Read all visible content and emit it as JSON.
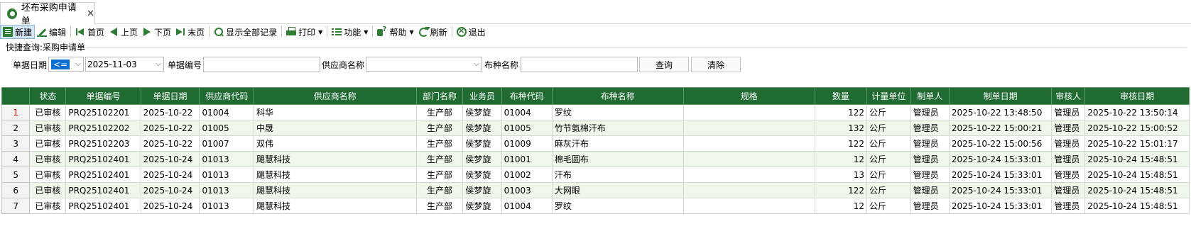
{
  "tab": {
    "title": "坯布采购申请单",
    "close": "✕"
  },
  "toolbar": {
    "new": "新建",
    "edit": "编辑",
    "first": "首页",
    "prev": "上页",
    "next": "下页",
    "last": "末页",
    "show_all": "显示全部记录",
    "print": "打印",
    "functions": "功能",
    "help": "帮助",
    "refresh": "刷新",
    "exit": "退出"
  },
  "quick_search": {
    "legend": "快捷查询:采购申请单",
    "date_label": "单据日期",
    "operator": "<=",
    "date_value": "2025-11-03",
    "doc_no_label": "单据编号",
    "doc_no_value": "",
    "supplier_label": "供应商名称",
    "supplier_value": "",
    "fabric_label": "布种名称",
    "fabric_value": "",
    "query_button": "查询",
    "clear_button": "清除"
  },
  "grid": {
    "columns": [
      "状态",
      "单据编号",
      "单据日期",
      "供应商代码",
      "供应商名称",
      "部门名称",
      "业务员",
      "布种代码",
      "布种名称",
      "规格",
      "数量",
      "计量单位",
      "制单人",
      "制单日期",
      "审核人",
      "审核日期"
    ],
    "rows": [
      {
        "n": "1",
        "cells": [
          "已审核",
          "PRQ25102201",
          "2025-10-22",
          "01004",
          "科华",
          "生产部",
          "侯梦旋",
          "01004",
          "罗纹",
          "",
          "122",
          "公斤",
          "管理员",
          "2025-10-22 13:48:50",
          "管理员",
          "2025-10-22 13:50:14"
        ]
      },
      {
        "n": "2",
        "cells": [
          "已审核",
          "PRQ25102202",
          "2025-10-22",
          "01005",
          "中晟",
          "生产部",
          "侯梦旋",
          "01005",
          "竹节氨棉汗布",
          "",
          "132",
          "公斤",
          "管理员",
          "2025-10-22 15:00:21",
          "管理员",
          "2025-10-22 15:00:52"
        ]
      },
      {
        "n": "3",
        "cells": [
          "已审核",
          "PRQ25102203",
          "2025-10-22",
          "01007",
          "双伟",
          "生产部",
          "侯梦旋",
          "01009",
          "麻灰汗布",
          "",
          "122",
          "公斤",
          "管理员",
          "2025-10-22 15:00:56",
          "管理员",
          "2025-10-22 15:01:17"
        ]
      },
      {
        "n": "4",
        "cells": [
          "已审核",
          "PRQ25102401",
          "2025-10-24",
          "01013",
          "飓慧科技",
          "生产部",
          "侯梦旋",
          "01001",
          "棉毛圆布",
          "",
          "12",
          "公斤",
          "管理员",
          "2025-10-24 15:33:01",
          "管理员",
          "2025-10-24 15:48:51"
        ]
      },
      {
        "n": "5",
        "cells": [
          "已审核",
          "PRQ25102401",
          "2025-10-24",
          "01013",
          "飓慧科技",
          "生产部",
          "侯梦旋",
          "01002",
          "汗布",
          "",
          "13",
          "公斤",
          "管理员",
          "2025-10-24 15:33:01",
          "管理员",
          "2025-10-24 15:48:51"
        ]
      },
      {
        "n": "6",
        "cells": [
          "已审核",
          "PRQ25102401",
          "2025-10-24",
          "01013",
          "飓慧科技",
          "生产部",
          "侯梦旋",
          "01003",
          "大网眼",
          "",
          "122",
          "公斤",
          "管理员",
          "2025-10-24 15:33:01",
          "管理员",
          "2025-10-24 15:48:51"
        ]
      },
      {
        "n": "7",
        "cells": [
          "已审核",
          "PRQ25102401",
          "2025-10-24",
          "01013",
          "飓慧科技",
          "生产部",
          "侯梦旋",
          "01004",
          "罗纹",
          "",
          "12",
          "公斤",
          "管理员",
          "2025-10-24 15:33:01",
          "管理员",
          "2025-10-24 15:48:51"
        ]
      }
    ]
  },
  "colors": {
    "header_bg": "#1f6b32",
    "alt_row": "#eef7ea",
    "accent_blue": "#0a6ed1",
    "icon_green": "#2e7d32"
  }
}
